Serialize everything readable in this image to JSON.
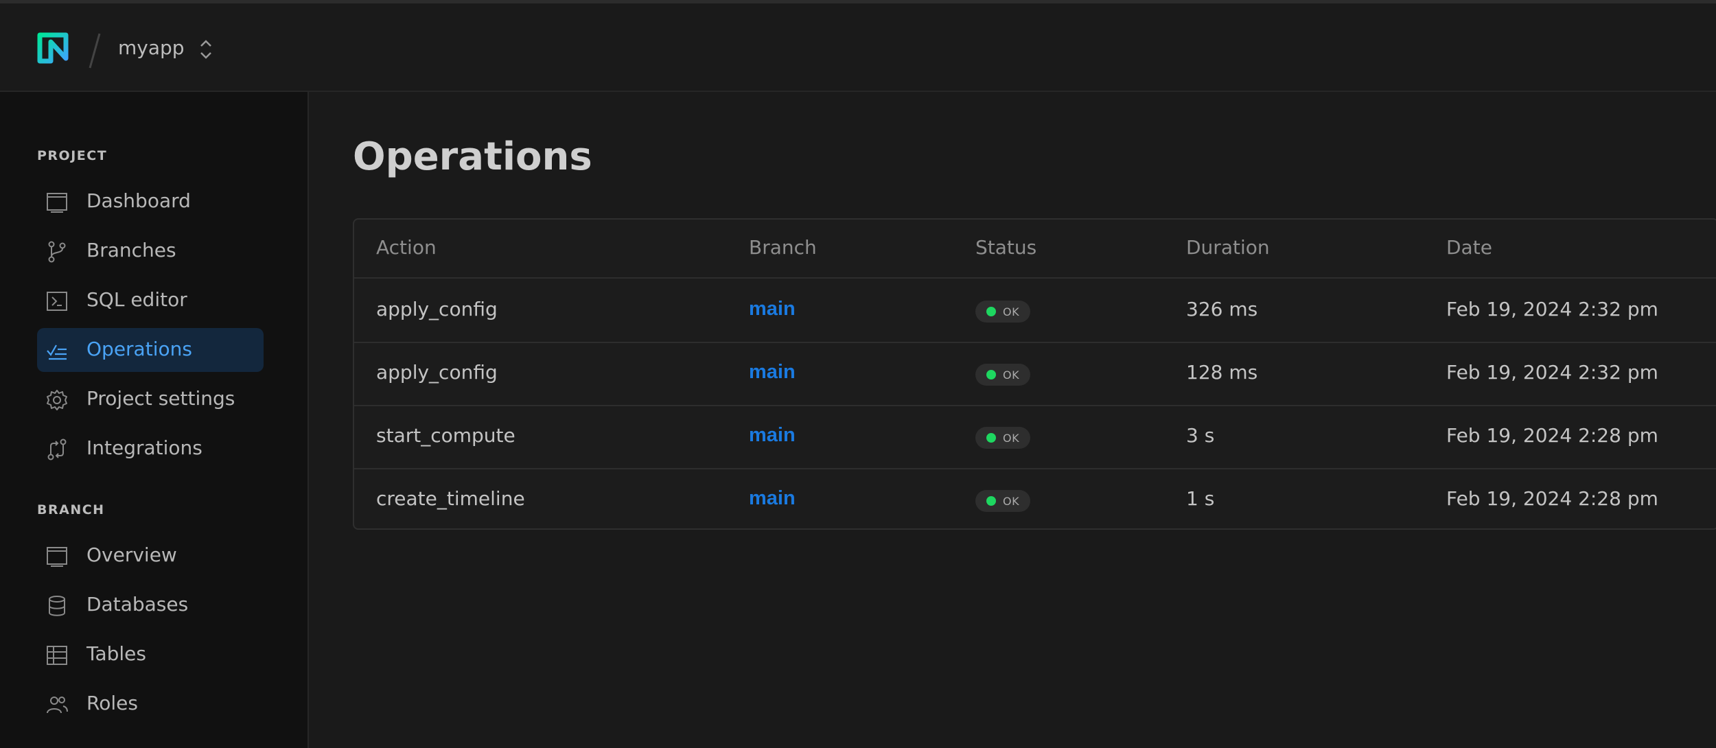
{
  "header": {
    "project_name": "myapp"
  },
  "sidebar": {
    "project_section": "PROJECT",
    "project_items": [
      {
        "label": "Dashboard",
        "icon": "dashboard-icon"
      },
      {
        "label": "Branches",
        "icon": "branches-icon"
      },
      {
        "label": "SQL editor",
        "icon": "sql-editor-icon"
      },
      {
        "label": "Operations",
        "icon": "operations-icon",
        "active": true
      },
      {
        "label": "Project settings",
        "icon": "gear-icon"
      },
      {
        "label": "Integrations",
        "icon": "integrations-icon"
      }
    ],
    "branch_section": "BRANCH",
    "branch_items": [
      {
        "label": "Overview",
        "icon": "overview-icon"
      },
      {
        "label": "Databases",
        "icon": "database-icon"
      },
      {
        "label": "Tables",
        "icon": "table-icon"
      },
      {
        "label": "Roles",
        "icon": "roles-icon"
      }
    ]
  },
  "main": {
    "title": "Operations",
    "columns": [
      "Action",
      "Branch",
      "Status",
      "Duration",
      "Date"
    ],
    "rows": [
      {
        "action": "apply_config",
        "branch": "main",
        "status": "OK",
        "duration": "326 ms",
        "date": "Feb 19, 2024 2:32 pm"
      },
      {
        "action": "apply_config",
        "branch": "main",
        "status": "OK",
        "duration": "128 ms",
        "date": "Feb 19, 2024 2:32 pm"
      },
      {
        "action": "start_compute",
        "branch": "main",
        "status": "OK",
        "duration": "3 s",
        "date": "Feb 19, 2024 2:28 pm"
      },
      {
        "action": "create_timeline",
        "branch": "main",
        "status": "OK",
        "duration": "1 s",
        "date": "Feb 19, 2024 2:28 pm"
      }
    ]
  },
  "colors": {
    "background": "#1a1a1a",
    "sidebar": "#111111",
    "accent": "#4aa3f5",
    "branch_link": "#1a7ae0",
    "status_ok": "#1ed760",
    "logo_gradient_start": "#00e599",
    "logo_gradient_end": "#3fa4ff"
  }
}
